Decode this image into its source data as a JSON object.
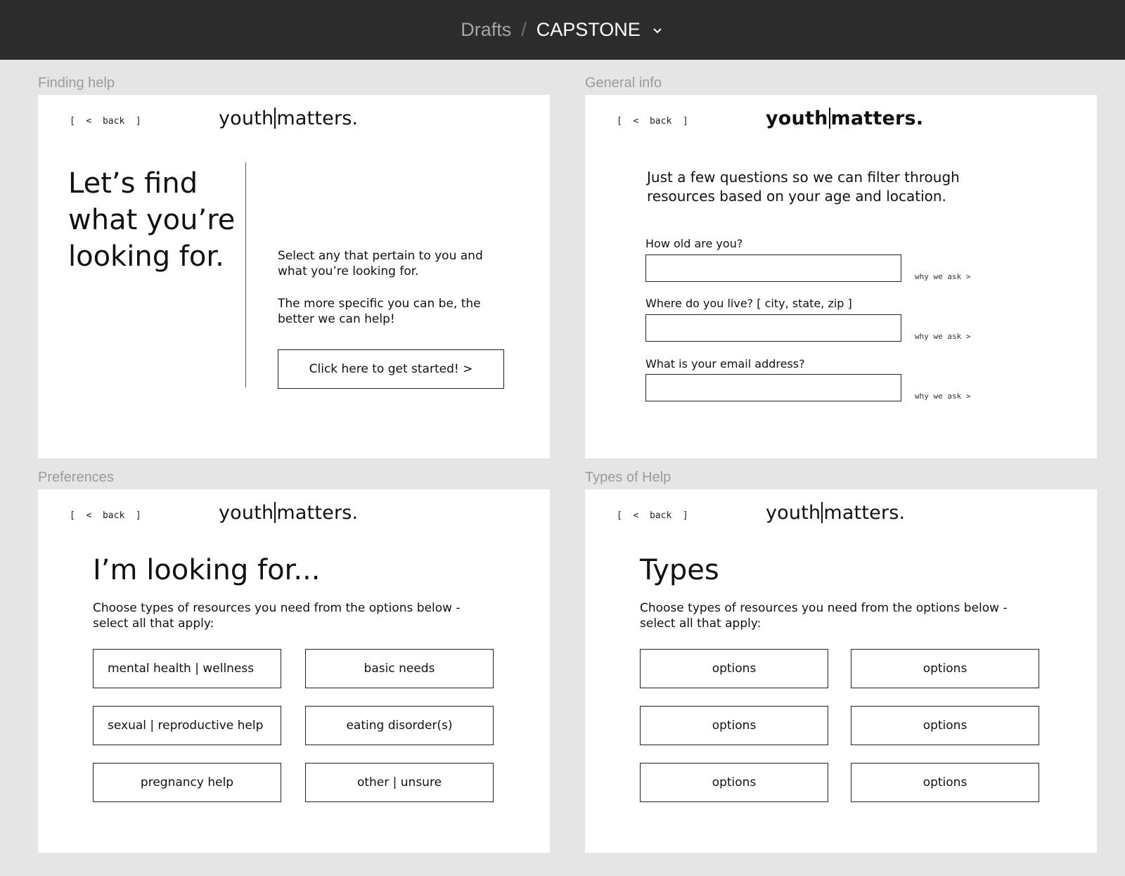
{
  "header": {
    "breadcrumb_parent": "Drafts",
    "separator": "/",
    "project_name": "CAPSTONE",
    "bg_color": "#2c2c2c"
  },
  "brand": {
    "logo_left": "youth",
    "logo_right": "matters."
  },
  "back_label": "[  <  back  ]",
  "frames": {
    "finding_help": {
      "label": "Finding help",
      "title": "Let’s find\nwhat you’re\nlooking for.",
      "para1": "Select any that pertain to you and what you’re looking for.",
      "para2": "The more specific you can be, the better we can help!",
      "cta": "Click here to get started!  >"
    },
    "general_info": {
      "label": "General info",
      "intro": "Just a few questions so we can filter through resources based on your age and location.",
      "questions": [
        {
          "label": "How old are you?",
          "why": "why we ask >"
        },
        {
          "label": "Where do you live? [ city, state, zip ]",
          "why": "why we ask >"
        },
        {
          "label": "What is your email address?",
          "why": "why we ask >"
        }
      ]
    },
    "preferences": {
      "label": "Preferences",
      "title": "I’m looking for...",
      "subtitle": "Choose types of resources you need from the options below - select all that apply:",
      "options": [
        "mental health | wellness",
        "basic needs",
        "sexual | reproductive help",
        "eating disorder(s)",
        "pregnancy help",
        "other | unsure"
      ]
    },
    "types_of_help": {
      "label": "Types of Help",
      "title": "Types",
      "subtitle": "Choose types of resources you need from the options below - select all that apply:",
      "options": [
        "options",
        "options",
        "options",
        "options",
        "options",
        "options"
      ]
    }
  }
}
